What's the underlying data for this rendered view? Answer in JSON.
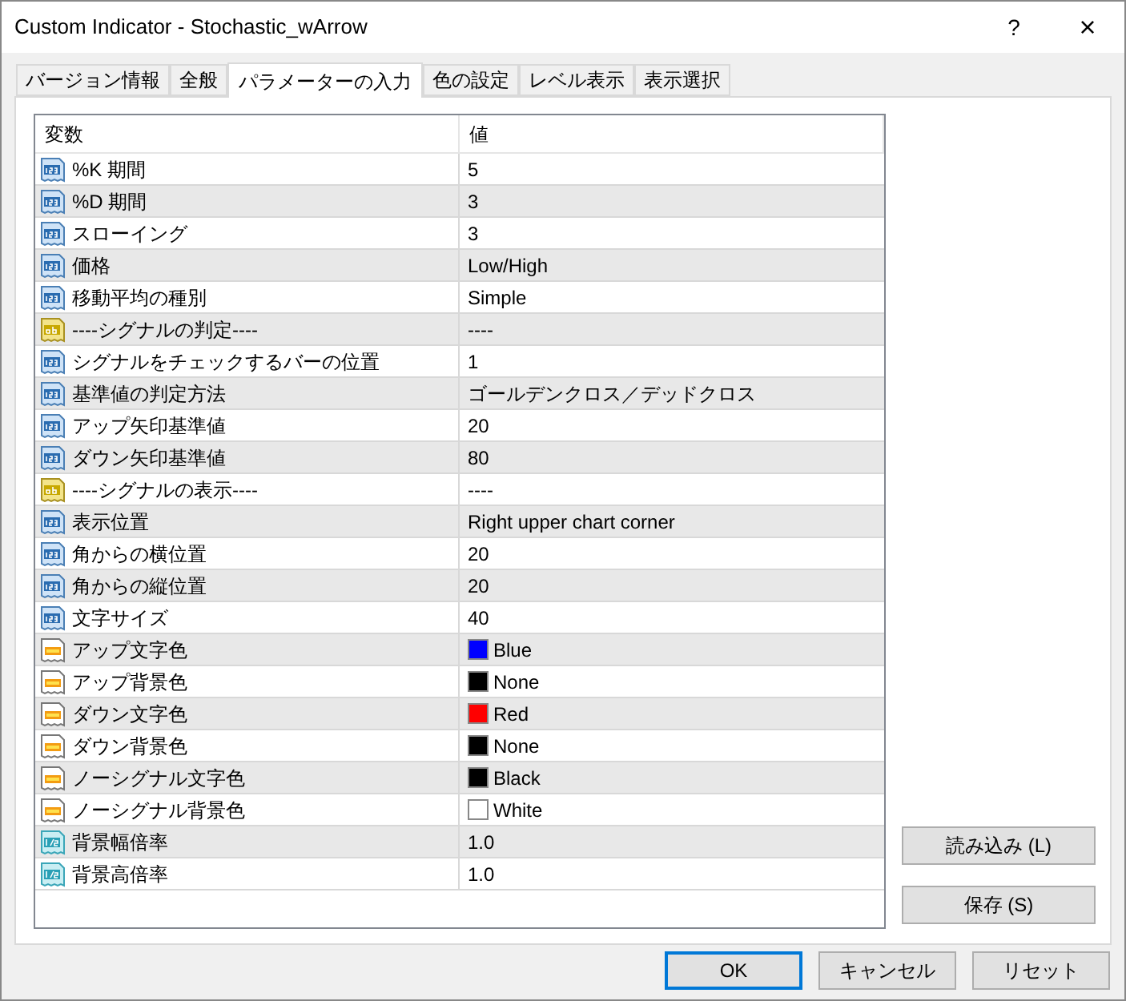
{
  "window": {
    "title": "Custom Indicator - Stochastic_wArrow",
    "help": "?",
    "close": "×"
  },
  "tabs": [
    {
      "label": "バージョン情報",
      "selected": false
    },
    {
      "label": "全般",
      "selected": false
    },
    {
      "label": "パラメーターの入力",
      "selected": true
    },
    {
      "label": "色の設定",
      "selected": false
    },
    {
      "label": "レベル表示",
      "selected": false
    },
    {
      "label": "表示選択",
      "selected": false
    }
  ],
  "table": {
    "columns": [
      "変数",
      "値"
    ],
    "rows": [
      {
        "kind": "int",
        "name": "%K 期間",
        "value": "5"
      },
      {
        "kind": "int",
        "name": "%D 期間",
        "value": "3"
      },
      {
        "kind": "int",
        "name": "スローイング",
        "value": "3"
      },
      {
        "kind": "int",
        "name": "価格",
        "value": "Low/High"
      },
      {
        "kind": "int",
        "name": "移動平均の種別",
        "value": "Simple"
      },
      {
        "kind": "string",
        "name": "----シグナルの判定----",
        "value": "----"
      },
      {
        "kind": "int",
        "name": "シグナルをチェックするバーの位置",
        "value": "1"
      },
      {
        "kind": "int",
        "name": "基準値の判定方法",
        "value": "ゴールデンクロス／デッドクロス"
      },
      {
        "kind": "int",
        "name": "アップ矢印基準値",
        "value": "20"
      },
      {
        "kind": "int",
        "name": "ダウン矢印基準値",
        "value": "80"
      },
      {
        "kind": "string",
        "name": "----シグナルの表示----",
        "value": "----"
      },
      {
        "kind": "int",
        "name": "表示位置",
        "value": "Right upper chart corner"
      },
      {
        "kind": "int",
        "name": "角からの横位置",
        "value": "20"
      },
      {
        "kind": "int",
        "name": "角からの縦位置",
        "value": "20"
      },
      {
        "kind": "int",
        "name": "文字サイズ",
        "value": "40"
      },
      {
        "kind": "color",
        "name": "アップ文字色",
        "value": "Blue",
        "color": "#0000ff"
      },
      {
        "kind": "color",
        "name": "アップ背景色",
        "value": "None",
        "color": "#000000"
      },
      {
        "kind": "color",
        "name": "ダウン文字色",
        "value": "Red",
        "color": "#ff0000"
      },
      {
        "kind": "color",
        "name": "ダウン背景色",
        "value": "None",
        "color": "#000000"
      },
      {
        "kind": "color",
        "name": "ノーシグナル文字色",
        "value": "Black",
        "color": "#000000"
      },
      {
        "kind": "color",
        "name": "ノーシグナル背景色",
        "value": "White",
        "color": "#ffffff"
      },
      {
        "kind": "double",
        "name": "背景幅倍率",
        "value": "1.0"
      },
      {
        "kind": "double",
        "name": "背景高倍率",
        "value": "1.0"
      }
    ]
  },
  "side_buttons": [
    "読み込み (L)",
    "保存 (S)"
  ],
  "buttons": [
    {
      "label": "OK",
      "default": true
    },
    {
      "label": "キャンセル",
      "default": false
    },
    {
      "label": "リセット",
      "default": false
    }
  ]
}
